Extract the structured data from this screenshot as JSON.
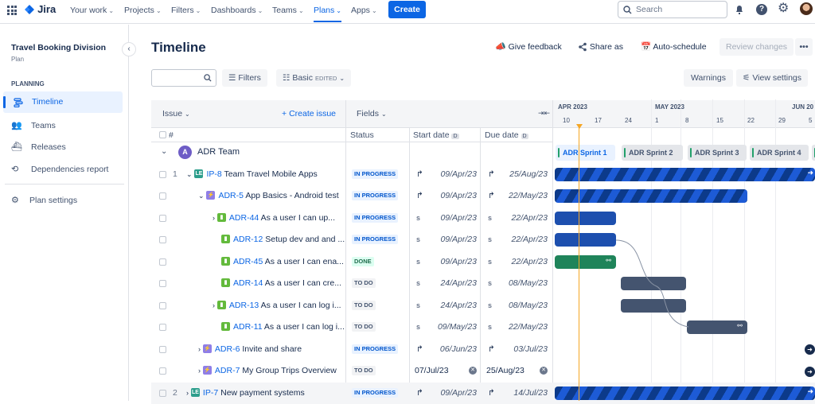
{
  "topnav": {
    "logo": "Jira",
    "items": [
      "Your work",
      "Projects",
      "Filters",
      "Dashboards",
      "Teams",
      "Plans",
      "Apps"
    ],
    "create": "Create",
    "search_placeholder": "Search"
  },
  "sidebar": {
    "title": "Travel Booking Division",
    "subtitle": "Plan",
    "section": "PLANNING",
    "items": [
      "Timeline",
      "Teams",
      "Releases",
      "Dependencies report"
    ],
    "settings": "Plan settings"
  },
  "page": {
    "title": "Timeline",
    "give_feedback": "Give feedback",
    "share": "Share as",
    "auto_schedule": "Auto-schedule",
    "review": "Review changes"
  },
  "toolbar": {
    "filters": "Filters",
    "view": "Basic",
    "edited": "EDITED",
    "warnings": "Warnings",
    "view_settings": "View settings"
  },
  "table": {
    "issue_header": "Issue",
    "create_issue": "Create issue",
    "fields": "Fields",
    "hash": "#",
    "status": "Status",
    "start": "Start date",
    "due": "Due date",
    "date_badge": "D"
  },
  "team": {
    "initial": "A",
    "name": "ADR Team"
  },
  "rows": [
    {
      "num": "1",
      "key": "IP-8",
      "summary": "Team Travel Mobile Apps",
      "status": "IN PROGRESS",
      "start": "09/Apr/23",
      "due": "25/Aug/23"
    },
    {
      "num": "",
      "key": "ADR-5",
      "summary": "App Basics - Android test",
      "status": "IN PROGRESS",
      "start": "09/Apr/23",
      "due": "22/May/23"
    },
    {
      "num": "",
      "key": "ADR-44",
      "summary": "As a user I can up...",
      "status": "IN PROGRESS",
      "start": "09/Apr/23",
      "due": "22/Apr/23"
    },
    {
      "num": "",
      "key": "ADR-12",
      "summary": "Setup dev and and ...",
      "status": "IN PROGRESS",
      "start": "09/Apr/23",
      "due": "22/Apr/23"
    },
    {
      "num": "",
      "key": "ADR-45",
      "summary": "As a user I can ena...",
      "status": "DONE",
      "start": "09/Apr/23",
      "due": "22/Apr/23"
    },
    {
      "num": "",
      "key": "ADR-14",
      "summary": "As a user I can cre...",
      "status": "TO DO",
      "start": "24/Apr/23",
      "due": "08/May/23"
    },
    {
      "num": "",
      "key": "ADR-13",
      "summary": "As a user I can log i...",
      "status": "TO DO",
      "start": "24/Apr/23",
      "due": "08/May/23"
    },
    {
      "num": "",
      "key": "ADR-11",
      "summary": "As a user I can log i...",
      "status": "TO DO",
      "start": "09/May/23",
      "due": "22/May/23"
    },
    {
      "num": "",
      "key": "ADR-6",
      "summary": "Invite and share",
      "status": "IN PROGRESS",
      "start": "06/Jun/23",
      "due": "03/Jul/23"
    },
    {
      "num": "",
      "key": "ADR-7",
      "summary": "My Group Trips Overview",
      "status": "TO DO",
      "start": "07/Jul/23",
      "due": "25/Aug/23"
    },
    {
      "num": "2",
      "key": "IP-7",
      "summary": "New payment systems",
      "status": "IN PROGRESS",
      "start": "09/Apr/23",
      "due": "14/Jul/23"
    }
  ],
  "timeline": {
    "months": [
      "APR 2023",
      "MAY 2023",
      "JUN 20"
    ],
    "days": [
      "10",
      "17",
      "24",
      "1",
      "8",
      "15",
      "22",
      "29",
      "5"
    ],
    "sprints": [
      "ADR Sprint 1",
      "ADR Sprint 2",
      "ADR Sprint 3",
      "ADR Sprint 4"
    ]
  },
  "colors": {
    "accent": "#0c66e4",
    "done_bar": "#1f845a",
    "todo_bar": "#44546f",
    "today": "#f5a623"
  }
}
